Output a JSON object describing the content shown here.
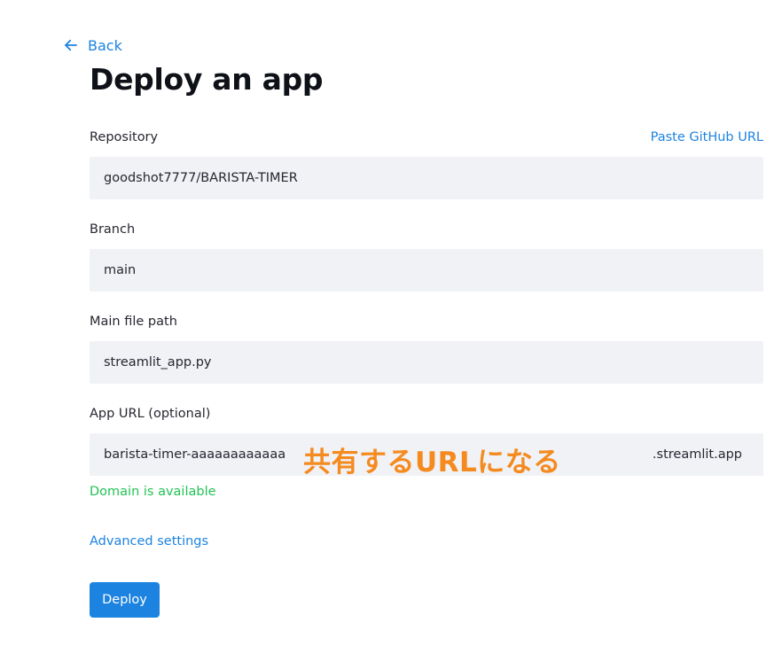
{
  "nav": {
    "back_label": "Back",
    "back_icon": "arrow-left-icon"
  },
  "page": {
    "title": "Deploy an app"
  },
  "form": {
    "repository": {
      "label": "Repository",
      "value": "goodshot7777/BARISTA-TIMER",
      "paste_link": "Paste GitHub URL"
    },
    "branch": {
      "label": "Branch",
      "value": "main"
    },
    "main_file": {
      "label": "Main file path",
      "value": "streamlit_app.py"
    },
    "app_url": {
      "label": "App URL (optional)",
      "value": "barista-timer-aaaaaaaaaaaa",
      "suffix": ".streamlit.app",
      "status": "Domain is available"
    },
    "advanced_settings": "Advanced settings",
    "deploy_label": "Deploy"
  },
  "annotation": {
    "text": "共有するURLになる",
    "color": "#f58a1f"
  },
  "colors": {
    "accent": "#1c83e1",
    "success": "#21c354",
    "input_bg": "#f0f2f6"
  }
}
